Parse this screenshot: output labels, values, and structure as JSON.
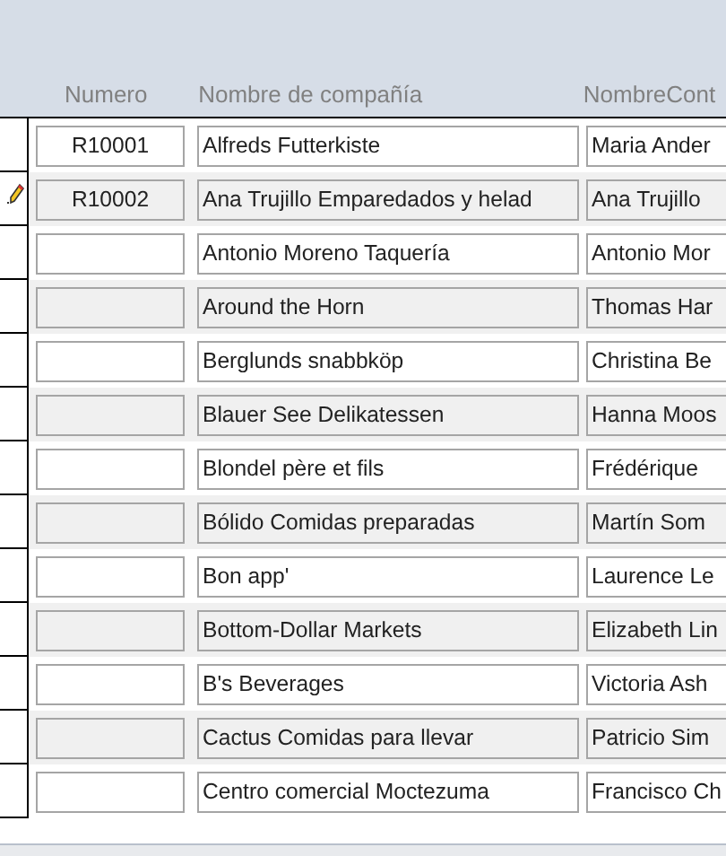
{
  "columns": [
    "Numero",
    "Nombre de compañía",
    "NombreCont"
  ],
  "rows": [
    {
      "numero": "R10001",
      "company": "Alfreds Futterkiste",
      "contact": "Maria Ander",
      "editing": false
    },
    {
      "numero": "R10002",
      "company": "Ana Trujillo Emparedados y helad",
      "contact": "Ana Trujillo",
      "editing": true
    },
    {
      "company": "Antonio Moreno Taquería",
      "contact": "Antonio Mor",
      "editing": false
    },
    {
      "company": "Around the Horn",
      "contact": "Thomas Har",
      "editing": false
    },
    {
      "company": "Berglunds snabbköp",
      "contact": "Christina Be",
      "editing": false
    },
    {
      "company": "Blauer See Delikatessen",
      "contact": "Hanna Moos",
      "editing": false
    },
    {
      "company": "Blondel père et fils",
      "contact": "Frédérique",
      "editing": false
    },
    {
      "company": "Bólido Comidas preparadas",
      "contact": "Martín Som",
      "editing": false
    },
    {
      "company": "Bon app'",
      "contact": "Laurence Le",
      "editing": false
    },
    {
      "company": "Bottom-Dollar Markets",
      "contact": "Elizabeth Lin",
      "editing": false
    },
    {
      "company": "B's Beverages",
      "contact": "Victoria Ash",
      "editing": false
    },
    {
      "company": "Cactus Comidas para llevar",
      "contact": "Patricio Sim",
      "editing": false
    },
    {
      "company": "Centro comercial Moctezuma",
      "contact": "Francisco Ch",
      "editing": false
    }
  ]
}
